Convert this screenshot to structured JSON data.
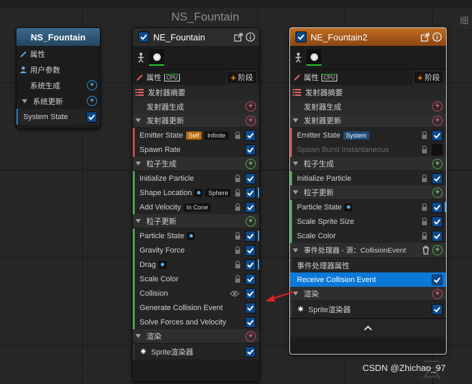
{
  "canvas_title": "NS_Fountain",
  "corner_text": "细",
  "watermark": "CSDN @Zhichao_97",
  "system_node": {
    "title": "NS_Fountain",
    "items": [
      {
        "label": "属性",
        "icon": "pencil-icon"
      },
      {
        "label": "用户参数",
        "icon": "user-icon"
      },
      {
        "label": "系统生成"
      },
      {
        "label": "系统更新"
      },
      {
        "label": "System State",
        "checked": true
      }
    ]
  },
  "emitter1": {
    "title": "NE_Fountain",
    "props_label": "属性",
    "cpu_label": "CPU",
    "stage_label": "阶段",
    "summary_label": "发射器摘要",
    "spawn_label": "发射器生成",
    "update_label": "发射器更新",
    "emitter_state": {
      "label": "Emitter State",
      "tag1": "Self",
      "tag2": "Infinite"
    },
    "spawn_rate": "Spawn Rate",
    "particle_spawn_label": "粒子生成",
    "spawn_modules": [
      {
        "label": "Initialize Particle"
      },
      {
        "label": "Shape Location",
        "tag": "Sphere"
      },
      {
        "label": "Add Velocity",
        "tag": "In Cone"
      }
    ],
    "particle_update_label": "粒子更新",
    "update_modules": [
      {
        "label": "Particle State"
      },
      {
        "label": "Gravity Force"
      },
      {
        "label": "Drag"
      },
      {
        "label": "Scale Color"
      },
      {
        "label": "Collision"
      },
      {
        "label": "Generate Collision Event"
      },
      {
        "label": "Solve Forces and Velocity"
      }
    ],
    "render_label": "渲染",
    "renderer": "Sprite渲染器"
  },
  "emitter2": {
    "title": "NE_Fountain2",
    "props_label": "属性",
    "cpu_label": "CPU",
    "stage_label": "阶段",
    "summary_label": "发射器摘要",
    "spawn_label": "发射器生成",
    "update_label": "发射器更新",
    "emitter_state": {
      "label": "Emitter State",
      "tag": "System"
    },
    "spawn_burst": "Spawn Burst Instantaneous",
    "particle_spawn_label": "粒子生成",
    "init_particle": "Initialize Particle",
    "particle_update_label": "粒子更新",
    "update_modules": [
      {
        "label": "Particle State"
      },
      {
        "label": "Scale Sprite Size"
      },
      {
        "label": "Scale Color"
      }
    ],
    "event_handler_label": "事件处理器 - 源：CollisionEvent",
    "event_props": "事件处理器属性",
    "receive_collision": "Receive Collision Event",
    "render_label": "渲染",
    "renderer": "Sprite渲染器"
  },
  "colors": {
    "emitter_header": "#2a2a2a",
    "emitter2_header": "#b3631c",
    "system_header": "#2c4f6b",
    "selection": "#0a78d7"
  }
}
